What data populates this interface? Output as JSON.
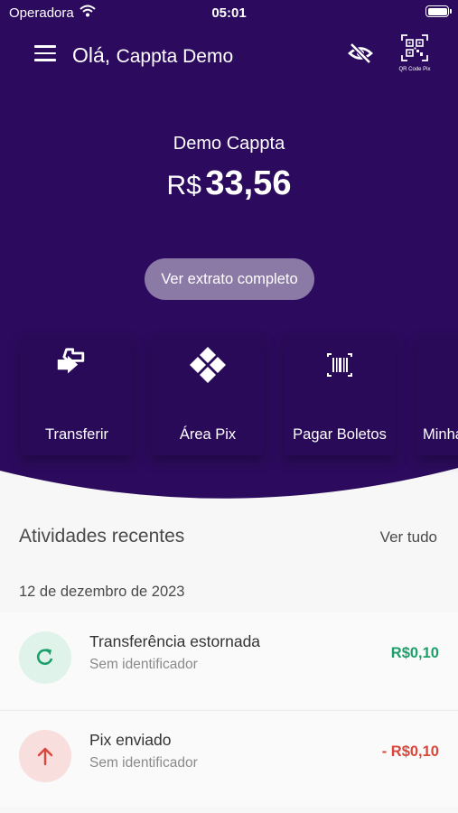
{
  "status_bar": {
    "carrier": "Operadora",
    "time": "05:01"
  },
  "header": {
    "greeting_prefix": "Olá,",
    "user_name": "Cappta Demo",
    "qr_label": "QR Code Pix",
    "icons": [
      "menu-icon",
      "eye-off-icon",
      "qr-code-icon"
    ]
  },
  "balance": {
    "account_name": "Demo Cappta",
    "currency": "R$",
    "amount": "33,56",
    "statement_button": "Ver extrato completo"
  },
  "actions": [
    {
      "label": "Transferir",
      "icon": "transfer-arrows-icon"
    },
    {
      "label": "Área Pix",
      "icon": "pix-icon"
    },
    {
      "label": "Pagar Boletos",
      "icon": "barcode-icon"
    },
    {
      "label": "Minha",
      "icon": ""
    }
  ],
  "recent": {
    "title": "Atividades recentes",
    "see_all": "Ver tudo",
    "date": "12 de dezembro de 2023",
    "items": [
      {
        "title": "Transferência estornada",
        "subtitle": "Sem identificador",
        "amount": "R$0,10",
        "icon": "refresh-icon",
        "color": "#1aa06b"
      },
      {
        "title": "Pix enviado",
        "subtitle": "Sem identificador",
        "amount": "- R$0,10",
        "icon": "arrow-up-icon",
        "color": "#d9463b"
      }
    ]
  },
  "colors": {
    "hero": "#2c0b5e",
    "green": "#1aa06b",
    "red": "#d9463b"
  }
}
